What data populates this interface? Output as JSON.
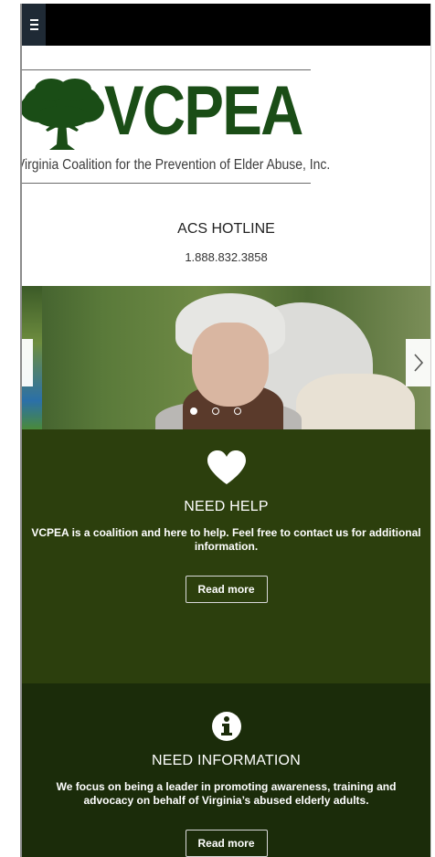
{
  "header": {
    "menu_icon": "hamburger-menu-icon"
  },
  "logo": {
    "wordmark": "VCPEA",
    "subtitle": "Virginia Coalition for the Prevention of Elder Abuse, Inc.",
    "icon": "oak-tree-icon",
    "brand_color": "#1a4d16"
  },
  "hotline": {
    "title": "ACS HOTLINE",
    "number": "1.888.832.3858"
  },
  "slider": {
    "prev_icon": "chevron-left-icon",
    "next_icon": "chevron-right-icon",
    "slide_count": 3,
    "active_slide": 1
  },
  "sections": {
    "need_help": {
      "icon": "heart-icon",
      "title": "NEED HELP",
      "text": "VCPEA is a coalition and here to help. Feel free to contact us for additional information.",
      "button_label": "Read more",
      "background": "#2c3f0d"
    },
    "need_information": {
      "icon": "info-circle-icon",
      "title": "NEED INFORMATION",
      "text": "We focus on being a leader in promoting awareness, training and advocacy on behalf of Virginia’s abused elderly adults.",
      "button_label": "Read more",
      "background": "#1b2c0a"
    }
  }
}
